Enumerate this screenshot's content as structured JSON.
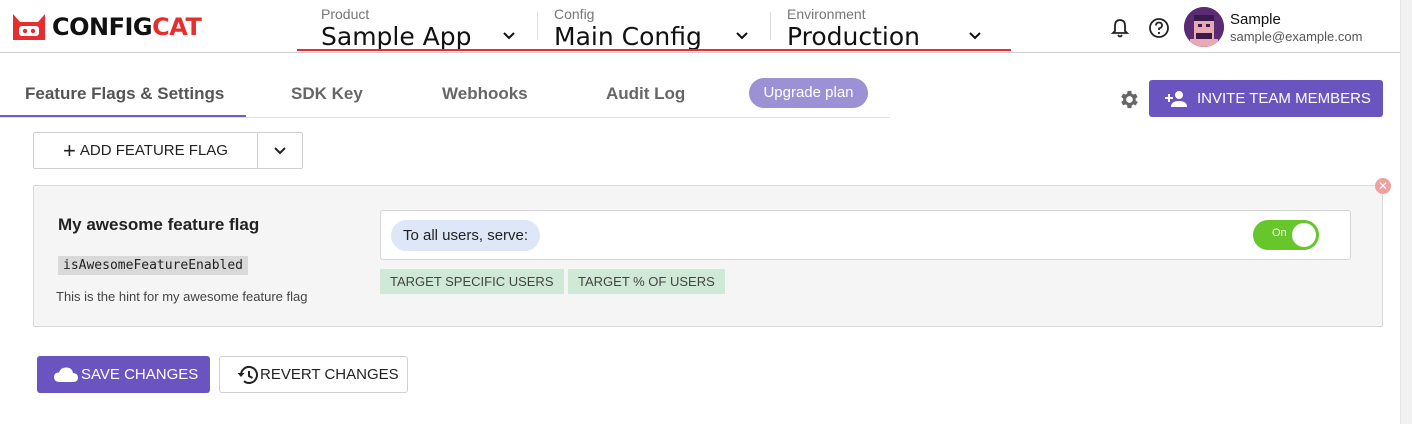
{
  "header": {
    "logo": {
      "text_main": "CONFIG",
      "text_accent": "CAT"
    },
    "selectors": [
      {
        "label": "Product",
        "value": "Sample App"
      },
      {
        "label": "Config",
        "value": "Main Config"
      },
      {
        "label": "Environment",
        "value": "Production"
      }
    ],
    "user": {
      "name": "Sample",
      "email": "sample@example.com"
    }
  },
  "tabs": [
    {
      "label": "Feature Flags & Settings",
      "active": true
    },
    {
      "label": "SDK Key"
    },
    {
      "label": "Webhooks"
    },
    {
      "label": "Audit Log"
    }
  ],
  "upgrade_label": "Upgrade plan",
  "invite_label": "INVITE TEAM MEMBERS",
  "add_flag_label": "ADD FEATURE FLAG",
  "flag": {
    "name": "My awesome feature flag",
    "key": "isAwesomeFeatureEnabled",
    "hint": "This is the hint for my awesome feature flag",
    "serve_label": "To all users, serve:",
    "toggle_label": "On",
    "toggle_on": true,
    "target_specific": "TARGET SPECIFIC USERS",
    "target_percent": "TARGET % OF USERS"
  },
  "actions": {
    "save_label": "SAVE CHANGES",
    "revert_label": "REVERT CHANGES"
  },
  "colors": {
    "accent": "#6a55c0",
    "brand_red": "#e62e2e",
    "toggle_on": "#66c62a",
    "target_chip": "#cfe9d6"
  }
}
